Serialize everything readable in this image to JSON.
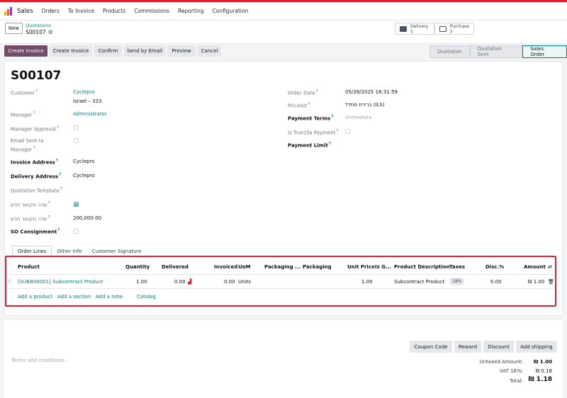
{
  "navbar": {
    "app_name": "Sales",
    "menu": [
      "Orders",
      "To Invoice",
      "Products",
      "Commissions",
      "Reporting",
      "Configuration"
    ]
  },
  "control_panel": {
    "new_label": "New",
    "breadcrumb_parent": "Quotations",
    "breadcrumb_current": "S00107",
    "smart_buttons": [
      {
        "label": "Delivery",
        "count": "1"
      },
      {
        "label": "Purchase",
        "count": "1"
      }
    ]
  },
  "actions": {
    "create_invoice_primary": "Create Invoice",
    "create_invoice": "Create Invoice",
    "confirm": "Confirm",
    "send_by_email": "Send by Email",
    "preview": "Preview",
    "cancel": "Cancel"
  },
  "statusbar": [
    "Quotation",
    "Quotation Sent",
    "Sales Order"
  ],
  "form": {
    "title": "S00107",
    "customer_label": "Customer",
    "customer_name": "Cyclepro",
    "customer_address": "Israel – 333",
    "manager_label": "Manager",
    "manager_value": "Administrator",
    "manager_approval_label": "Manager Approval",
    "email_sent_label_1": "Email Sent to",
    "email_sent_label_2": "Manager",
    "invoice_address_label": "Invoice Address",
    "invoice_address_value": "Cyclepro",
    "delivery_address_label": "Delivery Address",
    "delivery_address_value": "Cyclepro",
    "quotation_template_label": "Quotation Template",
    "custom_field_1_label": "שדה מקושר חדש",
    "custom_field_2_label": "שדה מקושר חדש",
    "custom_field_2_value": "200,000.00",
    "so_consignment_label": "SO Consignment",
    "order_date_label": "Order Date",
    "order_date_value": "05/28/2025 16:31:59",
    "pricelist_label": "Pricelist",
    "pricelist_value": "ברירת מחדל (ILS)",
    "payment_terms_label": "Payment Terms",
    "payment_terms_value": "Immediate",
    "tranzila_label": "Is Tranzila Payment",
    "payment_limit_label": "Payment Limit"
  },
  "tabs": [
    "Order Lines",
    "Other Info",
    "Customer Signature"
  ],
  "order_lines": {
    "headers": {
      "product": "Product",
      "quantity": "Quantity",
      "delivered": "Delivered",
      "invoiced": "Invoiced",
      "uom": "UoM",
      "packaging_qty": "Packaging ...",
      "packaging": "Packaging",
      "unit_price": "Unit Price",
      "is_g": "Is G...",
      "description": "Product Description",
      "taxes": "Taxes",
      "disc": "Disc.%",
      "amount": "Amount"
    },
    "row": {
      "product": "[SUBB00001] Subcontract Product",
      "quantity": "1.00",
      "delivered": "0.00",
      "invoiced": "0.00",
      "uom": "Units",
      "unit_price": "1.00",
      "description": "Subcontract Product",
      "tax": "18%",
      "disc": "0.00",
      "amount": "₪ 1.00"
    },
    "add_product": "Add a product",
    "add_section": "Add a section",
    "add_note": "Add a note",
    "catalog": "Catalog"
  },
  "footer": {
    "coupon_code": "Coupon Code",
    "reward": "Reward",
    "discount": "Discount",
    "add_shipping": "Add shipping",
    "terms_placeholder": "Terms and conditions...",
    "untaxed_label": "Untaxed Amount:",
    "untaxed_value": "₪ 1.00",
    "vat_label": "VAT 18%:",
    "vat_value": "₪ 0.18",
    "total_label": "Total:",
    "total_value": "₪ 1.18"
  },
  "colors": {
    "primary": "#714b67",
    "link": "#017e84",
    "highlight": "#e11d2e"
  }
}
